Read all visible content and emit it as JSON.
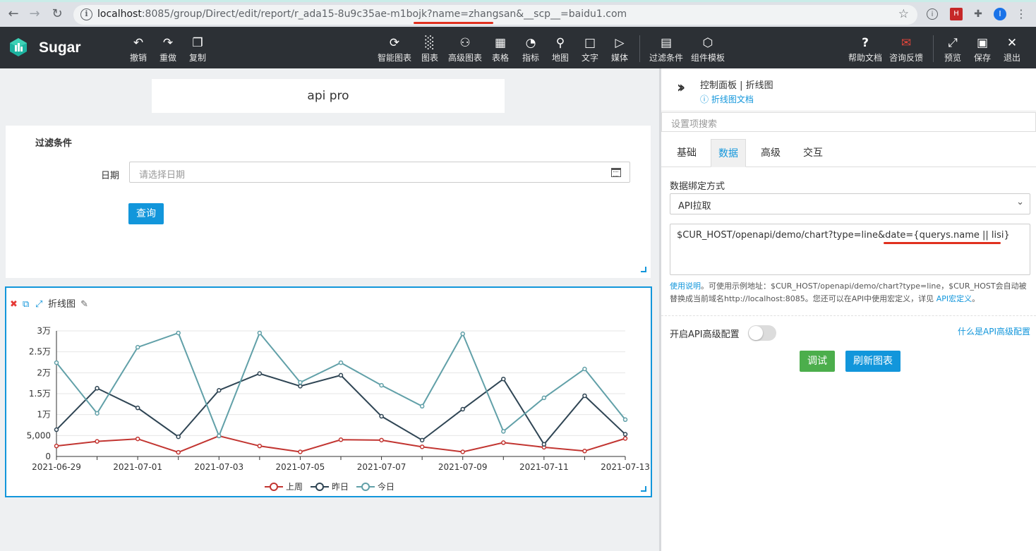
{
  "browser": {
    "url_host": "localhost",
    "url_rest": ":8085/group/Direct/edit/report/r_ada15-8u9c35ae-m1bojk?name=zhangsan&__scp__=baidu1.com",
    "profile_initial": "I",
    "ext_badge": "H"
  },
  "app": {
    "brand": "Sugar",
    "toolbar_left": [
      {
        "icon": "undo-icon",
        "label": "撤销"
      },
      {
        "icon": "redo-icon",
        "label": "重做"
      },
      {
        "icon": "copy-icon",
        "label": "复制"
      }
    ],
    "toolbar_center": [
      {
        "icon": "smart-chart-icon",
        "label": "智能图表"
      },
      {
        "icon": "chart-icon",
        "label": "图表"
      },
      {
        "icon": "advanced-chart-icon",
        "label": "高级图表"
      },
      {
        "icon": "table-icon",
        "label": "表格"
      },
      {
        "icon": "gauge-icon",
        "label": "指标"
      },
      {
        "icon": "map-icon",
        "label": "地图"
      },
      {
        "icon": "text-icon",
        "label": "文字"
      },
      {
        "icon": "media-icon",
        "label": "媒体"
      },
      {
        "icon": "filter-icon",
        "label": "过滤条件"
      },
      {
        "icon": "component-template-icon",
        "label": "组件模板"
      }
    ],
    "toolbar_right": [
      {
        "icon": "help-icon",
        "label": "帮助文档"
      },
      {
        "icon": "feedback-icon",
        "label": "咨询反馈"
      },
      {
        "icon": "preview-icon",
        "label": "预览"
      },
      {
        "icon": "save-icon",
        "label": "保存"
      },
      {
        "icon": "exit-icon",
        "label": "退出"
      }
    ]
  },
  "canvas": {
    "title": "api pro",
    "filter": {
      "title": "过滤条件",
      "date_label": "日期",
      "date_placeholder": "请选择日期",
      "query_button": "查询"
    },
    "chart_widget": {
      "title": "折线图"
    }
  },
  "panel": {
    "title": "控制面板 | 折线图",
    "doc_link": "折线图文档",
    "search_placeholder": "设置项搜索",
    "tabs": [
      "基础",
      "数据",
      "高级",
      "交互"
    ],
    "active_tab": "数据",
    "bind_label": "数据绑定方式",
    "bind_value": "API拉取",
    "api_url": "$CUR_HOST/openapi/demo/chart?type=line&date={querys.name || lisi}",
    "help_link": "使用说明",
    "help_text": "。可使用示例地址：$CUR_HOST/openapi/demo/chart?type=line，$CUR_HOST会自动被替换成当前域名http://localhost:8085。您还可以在API中使用宏定义，详见 ",
    "help_macro_link": "API宏定义",
    "help_end": "。",
    "advanced_label": "开启API高级配置",
    "advanced_link": "什么是API高级配置",
    "debug_button": "调试",
    "refresh_button": "刷新图表"
  },
  "colors": {
    "accent": "#1296db",
    "series_last_week": "#c23531",
    "series_yesterday": "#2f4554",
    "series_today": "#61a0a8"
  },
  "chart_data": {
    "type": "line",
    "x": [
      "2021-06-29",
      "2021-06-30",
      "2021-07-01",
      "2021-07-02",
      "2021-07-03",
      "2021-07-04",
      "2021-07-05",
      "2021-07-06",
      "2021-07-07",
      "2021-07-08",
      "2021-07-09",
      "2021-07-10",
      "2021-07-11",
      "2021-07-12",
      "2021-07-13"
    ],
    "x_tick_labels": [
      "2021-06-29",
      "2021-07-01",
      "2021-07-03",
      "2021-07-05",
      "2021-07-07",
      "2021-07-09",
      "2021-07-11",
      "2021-07-13"
    ],
    "y_tick_labels": [
      "0",
      "5,000",
      "1万",
      "1.5万",
      "2万",
      "2.5万",
      "3万"
    ],
    "ylim": [
      0,
      30000
    ],
    "grid": true,
    "legend_position": "bottom",
    "series": [
      {
        "name": "上周",
        "color": "#c23531",
        "values": [
          2500,
          3600,
          4200,
          1000,
          4900,
          2500,
          1100,
          4000,
          3900,
          2300,
          1100,
          3300,
          2200,
          1300,
          4300
        ]
      },
      {
        "name": "昨日",
        "color": "#2f4554",
        "values": [
          6400,
          16300,
          11600,
          4700,
          15800,
          19800,
          16800,
          19400,
          9600,
          3900,
          11300,
          18500,
          2900,
          14500,
          5300
        ]
      },
      {
        "name": "今日",
        "color": "#61a0a8",
        "values": [
          22400,
          10300,
          26100,
          29500,
          4900,
          29500,
          17700,
          22400,
          17000,
          12000,
          29300,
          6000,
          14000,
          20900,
          8800
        ]
      }
    ]
  }
}
